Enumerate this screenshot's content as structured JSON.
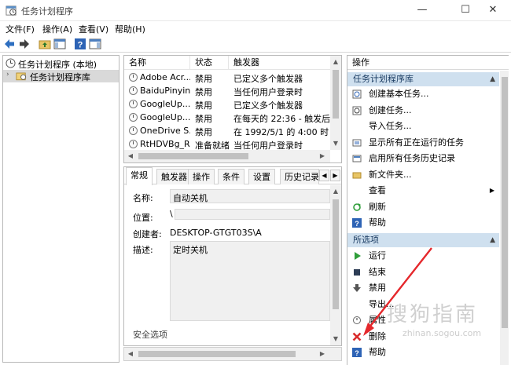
{
  "window": {
    "title": "任务计划程序",
    "minimize_glyph": "—",
    "maximize_glyph": "☐",
    "close_glyph": "✕"
  },
  "menubar": {
    "items": [
      "文件(F)",
      "操作(A)",
      "查看(V)",
      "帮助(H)"
    ]
  },
  "toolbar": {
    "icons": [
      "back-arrow-icon",
      "forward-arrow-icon",
      "folder-up-icon",
      "show-hide-console-tree-icon",
      "help-icon",
      "show-hide-action-pane-icon"
    ]
  },
  "tree": {
    "root_label": "任务计划程序 (本地)",
    "child_label": "任务计划程序库"
  },
  "task_list": {
    "columns": [
      "名称",
      "状态",
      "触发器"
    ],
    "rows": [
      {
        "name": "Adobe Acr...",
        "status": "禁用",
        "trigger": "已定义多个触发器"
      },
      {
        "name": "BaiduPinyin...",
        "status": "禁用",
        "trigger": "当任何用户登录时"
      },
      {
        "name": "GoogleUp...",
        "status": "禁用",
        "trigger": "已定义多个触发器"
      },
      {
        "name": "GoogleUp...",
        "status": "禁用",
        "trigger": "在每天的 22:36 - 触发后，"
      },
      {
        "name": "OneDrive S...",
        "status": "禁用",
        "trigger": "在 1992/5/1 的 4:00 时 -"
      },
      {
        "name": "RtHDVBg_R...",
        "status": "准备就绪",
        "trigger": "当任何用户登录时"
      }
    ]
  },
  "details": {
    "tabs": [
      "常规",
      "触发器",
      "操作",
      "条件",
      "设置",
      "历史记录"
    ],
    "active_tab": "常规",
    "name_label": "名称:",
    "name_value": "自动关机",
    "location_label": "位置:",
    "location_value": "\\",
    "author_label": "创建者:",
    "author_value": "DESKTOP-GTGT03S\\A",
    "description_label": "描述:",
    "description_value": "定时关机",
    "security_label": "安全选项"
  },
  "actions": {
    "pane_title": "操作",
    "section1_title": "任务计划程序库",
    "section1_items": [
      {
        "label": "创建基本任务...",
        "icon": "create-basic-task-icon"
      },
      {
        "label": "创建任务...",
        "icon": "create-task-icon"
      },
      {
        "label": "导入任务...",
        "icon": ""
      },
      {
        "label": "显示所有正在运行的任务",
        "icon": "running-tasks-icon"
      },
      {
        "label": "启用所有任务历史记录",
        "icon": "history-icon"
      },
      {
        "label": "新文件夹...",
        "icon": "folder-icon"
      },
      {
        "label": "查看",
        "icon": ""
      },
      {
        "label": "刷新",
        "icon": "refresh-icon"
      },
      {
        "label": "帮助",
        "icon": "help-icon"
      }
    ],
    "section2_title": "所选项",
    "section2_items": [
      {
        "label": "运行",
        "icon": "run-icon"
      },
      {
        "label": "结束",
        "icon": "end-icon"
      },
      {
        "label": "禁用",
        "icon": "disable-icon"
      },
      {
        "label": "导出...",
        "icon": ""
      },
      {
        "label": "属性",
        "icon": "properties-icon"
      },
      {
        "label": "删除",
        "icon": "delete-icon"
      },
      {
        "label": "帮助",
        "icon": "help-icon"
      }
    ]
  },
  "colors": {
    "section_header_bg": "#cfe0ef",
    "annotation_arrow": "#e5282c",
    "delete_icon": "#d92b2b",
    "run_icon": "#2f9e3a"
  },
  "watermark": {
    "text": "搜狗指南",
    "sub": "zhinan.sogou.com"
  }
}
